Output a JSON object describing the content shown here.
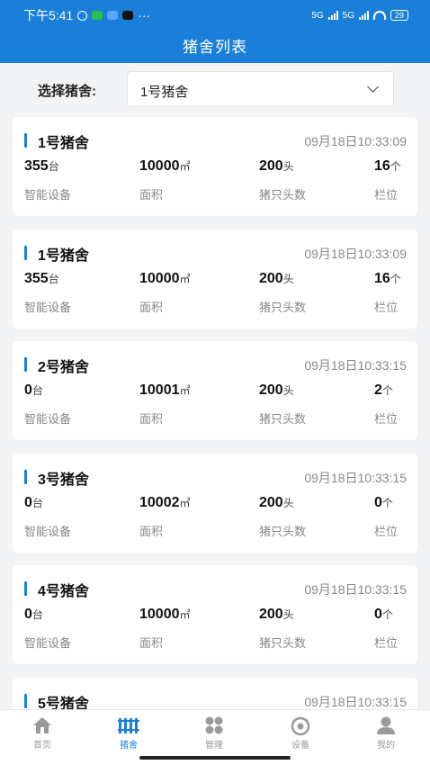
{
  "statusbar": {
    "time": "下午5:41",
    "more": "···",
    "network_left": "5G",
    "network_right": "5G",
    "battery": "29"
  },
  "header": {
    "title": "猪舍列表"
  },
  "filter": {
    "label": "选择猪舍:",
    "selected": "1号猪舍"
  },
  "labels": {
    "devices": "智能设备",
    "area": "面积",
    "pigs": "猪只头数",
    "pens": "栏位"
  },
  "units": {
    "devices": "台",
    "area": "㎡",
    "pigs": "头",
    "pens": "个"
  },
  "barns": [
    {
      "name": "1号猪舍",
      "time": "09月18日10:33:09",
      "devices": "355",
      "area": "10000",
      "pigs": "200",
      "pens": "16"
    },
    {
      "name": "1号猪舍",
      "time": "09月18日10:33:09",
      "devices": "355",
      "area": "10000",
      "pigs": "200",
      "pens": "16"
    },
    {
      "name": "2号猪舍",
      "time": "09月18日10:33:15",
      "devices": "0",
      "area": "10001",
      "pigs": "200",
      "pens": "2"
    },
    {
      "name": "3号猪舍",
      "time": "09月18日10:33:15",
      "devices": "0",
      "area": "10002",
      "pigs": "200",
      "pens": "0"
    },
    {
      "name": "4号猪舍",
      "time": "09月18日10:33:15",
      "devices": "0",
      "area": "10000",
      "pigs": "200",
      "pens": "0"
    },
    {
      "name": "5号猪舍",
      "time": "09月18日10:33:15"
    }
  ],
  "tabs": [
    {
      "label": "首页",
      "icon": "home-icon",
      "active": false
    },
    {
      "label": "猪舍",
      "icon": "barn-icon",
      "active": true
    },
    {
      "label": "管理",
      "icon": "grid-icon",
      "active": false
    },
    {
      "label": "设备",
      "icon": "device-icon",
      "active": false
    },
    {
      "label": "我的",
      "icon": "user-icon",
      "active": false
    }
  ],
  "colors": {
    "primary": "#1a7fd9",
    "background": "#f2f3f5",
    "muted_text": "#888888"
  }
}
